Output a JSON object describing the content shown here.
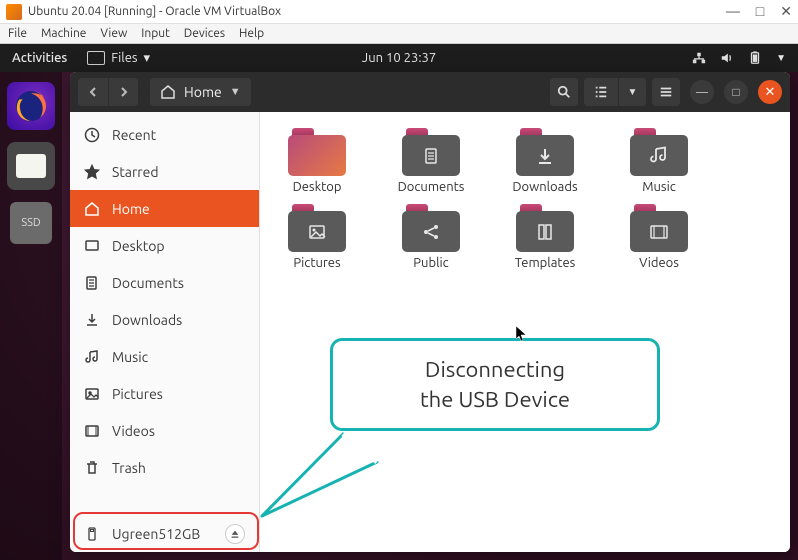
{
  "vbox": {
    "title": "Ubuntu 20.04 [Running] - Oracle VM VirtualBox",
    "menus": [
      "File",
      "Machine",
      "View",
      "Input",
      "Devices",
      "Help"
    ]
  },
  "panel": {
    "activities": "Activities",
    "files_label": "Files",
    "datetime": "Jun 10  23:37"
  },
  "dock": {
    "ssd_label": "SSD"
  },
  "nautilus": {
    "path_label": "Home",
    "sidebar": [
      {
        "icon": "clock",
        "label": "Recent"
      },
      {
        "icon": "star",
        "label": "Starred"
      },
      {
        "icon": "home",
        "label": "Home",
        "active": true
      },
      {
        "icon": "desktop",
        "label": "Desktop"
      },
      {
        "icon": "documents",
        "label": "Documents"
      },
      {
        "icon": "downloads",
        "label": "Downloads"
      },
      {
        "icon": "music",
        "label": "Music"
      },
      {
        "icon": "pictures",
        "label": "Pictures"
      },
      {
        "icon": "videos",
        "label": "Videos"
      },
      {
        "icon": "trash",
        "label": "Trash"
      }
    ],
    "mount": {
      "label": "Ugreen512GB"
    },
    "grid": [
      {
        "label": "Desktop",
        "gradient": true
      },
      {
        "label": "Documents",
        "glyph": "doc"
      },
      {
        "label": "Downloads",
        "glyph": "download"
      },
      {
        "label": "Music",
        "glyph": "music"
      },
      {
        "label": "Pictures",
        "glyph": "picture"
      },
      {
        "label": "Public",
        "glyph": "share"
      },
      {
        "label": "Templates",
        "glyph": "template"
      },
      {
        "label": "Videos",
        "glyph": "video"
      }
    ]
  },
  "callout": {
    "line1": "Disconnecting",
    "line2": "the USB Device"
  }
}
